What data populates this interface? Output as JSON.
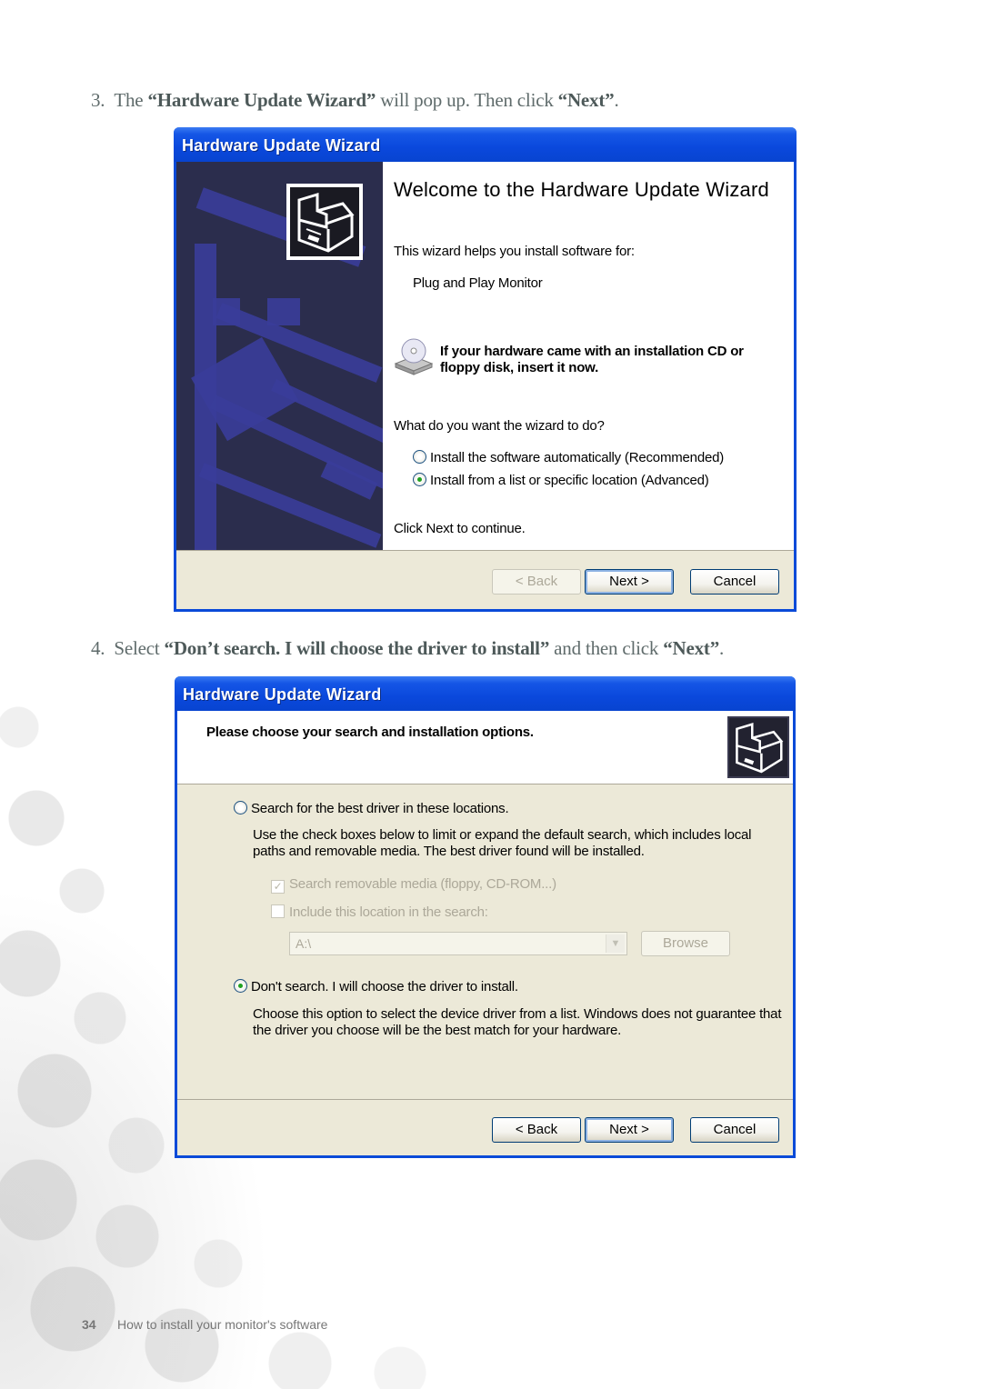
{
  "steps": [
    {
      "number": "3.",
      "parts": [
        {
          "text": "The ",
          "bold": false
        },
        {
          "text": "“Hardware Update Wizard”",
          "bold": true
        },
        {
          "text": " will pop up. Then click ",
          "bold": false
        },
        {
          "text": "“Next”",
          "bold": true
        },
        {
          "text": ".",
          "bold": false
        }
      ]
    },
    {
      "number": "4.",
      "parts": [
        {
          "text": "Select ",
          "bold": false
        },
        {
          "text": "“Don’t search. I will choose the driver to install”",
          "bold": true
        },
        {
          "text": " and then click ",
          "bold": false
        },
        {
          "text": "“Next”",
          "bold": true
        },
        {
          "text": ".",
          "bold": false
        }
      ]
    }
  ],
  "wizard1": {
    "title": "Hardware Update Wizard",
    "heading": "Welcome to the Hardware Update Wizard",
    "intro": "This wizard helps you install software for:",
    "device": "Plug and Play Monitor",
    "cd_notice": "If your hardware came with an installation CD or floppy disk, insert it now.",
    "question": "What do you want the wizard to do?",
    "options": [
      {
        "label": "Install the software automatically (Recommended)",
        "selected": false
      },
      {
        "label": "Install from a list or specific location (Advanced)",
        "selected": true
      }
    ],
    "continue_text": "Click Next to continue.",
    "buttons": {
      "back": "< Back",
      "next": "Next >",
      "cancel": "Cancel"
    },
    "back_disabled": true
  },
  "wizard2": {
    "title": "Hardware Update Wizard",
    "heading": "Please choose your search and installation options.",
    "option_search": {
      "label": "Search for the best driver in these locations.",
      "selected": false,
      "description": "Use the check boxes below to limit or expand the default search, which includes local paths and removable media. The best driver found will be installed.",
      "checkboxes": [
        {
          "label": "Search removable media (floppy, CD-ROM...)",
          "checked": true,
          "disabled": true
        },
        {
          "label": "Include this location in the search:",
          "checked": false,
          "disabled": true
        }
      ],
      "location_value": "A:\\",
      "browse_label": "Browse"
    },
    "option_dont_search": {
      "label": "Don't search. I will choose the driver to install.",
      "selected": true,
      "description": "Choose this option to select the device driver from a list.  Windows does not guarantee that the driver you choose will be the best match for your hardware."
    },
    "buttons": {
      "back": "< Back",
      "next": "Next >",
      "cancel": "Cancel"
    }
  },
  "footer": {
    "page_number": "34",
    "section": "How to install your monitor's software"
  },
  "colors": {
    "titlebar": "#0a48dc",
    "dialog_bg": "#ece9d8",
    "sidebar": "#2b2d4d",
    "step_text": "#5f6b6b"
  }
}
